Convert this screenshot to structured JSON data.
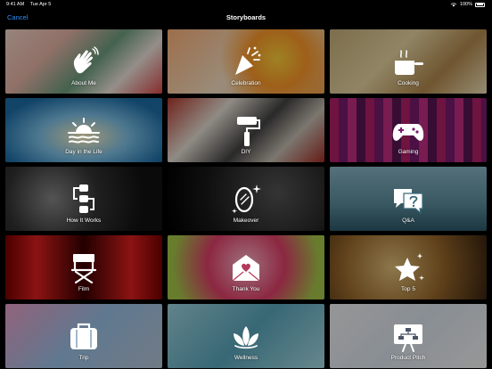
{
  "status": {
    "time": "9:41 AM",
    "date": "Tue Apr 5",
    "battery": "100%"
  },
  "nav": {
    "cancel": "Cancel",
    "title": "Storyboards"
  },
  "tiles": [
    {
      "label": "About Me",
      "icon": "waving-hand-icon"
    },
    {
      "label": "Celebration",
      "icon": "party-popper-icon"
    },
    {
      "label": "Cooking",
      "icon": "cooking-pot-icon"
    },
    {
      "label": "Day in the Life",
      "icon": "sunrise-icon"
    },
    {
      "label": "DIY",
      "icon": "paint-roller-icon"
    },
    {
      "label": "Gaming",
      "icon": "game-controller-icon"
    },
    {
      "label": "How It Works",
      "icon": "flowchart-icon"
    },
    {
      "label": "Makeover",
      "icon": "mirror-icon"
    },
    {
      "label": "Q&A",
      "icon": "question-bubbles-icon"
    },
    {
      "label": "Film",
      "icon": "directors-chair-icon"
    },
    {
      "label": "Thank You",
      "icon": "heart-envelope-icon"
    },
    {
      "label": "Top 5",
      "icon": "star-icon"
    },
    {
      "label": "Trip",
      "icon": "suitcase-icon"
    },
    {
      "label": "Wellness",
      "icon": "lotus-icon"
    },
    {
      "label": "Product Pitch",
      "icon": "presentation-chart-icon"
    }
  ]
}
